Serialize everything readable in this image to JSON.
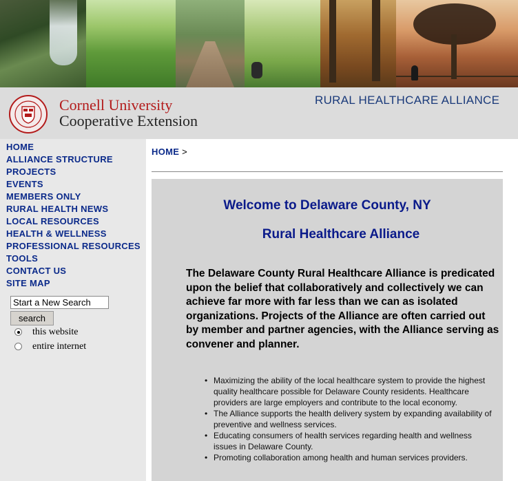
{
  "header": {
    "university_name": "Cornell University",
    "university_sub": "Cooperative Extension",
    "site_title": "RURAL HEALTHCARE ALLIANCE",
    "brand_red": "#b31b1b",
    "brand_blue": "#1a3a7a"
  },
  "sidebar": {
    "nav": [
      {
        "label": "HOME"
      },
      {
        "label": "ALLIANCE STRUCTURE"
      },
      {
        "label": "PROJECTS"
      },
      {
        "label": "EVENTS"
      },
      {
        "label": "MEMBERS ONLY"
      },
      {
        "label": "RURAL HEALTH NEWS"
      },
      {
        "label": "LOCAL RESOURCES"
      },
      {
        "label": "HEALTH & WELLNESS"
      },
      {
        "label": "PROFESSIONAL RESOURCES"
      },
      {
        "label": "TOOLS"
      },
      {
        "label": "CONTACT US"
      },
      {
        "label": "SITE MAP"
      }
    ],
    "search": {
      "value": "Start a New Search",
      "button_label": "search",
      "options": [
        {
          "label": "this website",
          "checked": true
        },
        {
          "label": "entire internet",
          "checked": false
        }
      ]
    }
  },
  "main": {
    "breadcrumb": {
      "home": "HOME",
      "separator": ">"
    },
    "welcome": "Welcome to Delaware County, NY",
    "subtitle": "Rural Healthcare Alliance",
    "intro": "The Delaware County Rural Healthcare Alliance is predicated upon the belief that collaboratively and collectively we can achieve far more with far less than we can as isolated organizations.  Projects of the Alliance are often carried out by member and partner agencies, with the Alliance serving as convener and planner.",
    "bullets": [
      "Maximizing the ability of the local healthcare system to provide the highest quality healthcare possible for Delaware County residents. Healthcare providers are large employers and contribute to the local economy.",
      "The Alliance supports the health delivery system by expanding availability of preventive and wellness services.",
      "Educating consumers of health services regarding health and wellness issues in Delaware County.",
      "Promoting collaboration among health and human services providers."
    ]
  }
}
